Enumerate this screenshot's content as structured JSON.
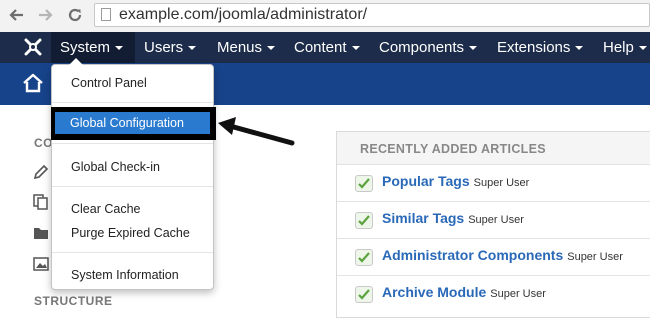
{
  "browser": {
    "url": "example.com/joomla/administrator/",
    "back_icon": "arrow-left-icon",
    "forward_icon": "arrow-right-icon",
    "reload_icon": "reload-icon"
  },
  "nav": {
    "logo": "joomla-logo-icon",
    "items": [
      {
        "label": "System"
      },
      {
        "label": "Users"
      },
      {
        "label": "Menus"
      },
      {
        "label": "Content"
      },
      {
        "label": "Components"
      },
      {
        "label": "Extensions"
      },
      {
        "label": "Help"
      }
    ]
  },
  "dropdown": {
    "items": [
      {
        "label": "Control Panel"
      },
      {
        "label": "Global Configuration",
        "highlighted": true
      },
      {
        "label": "Global Check-in"
      },
      {
        "label": "Clear Cache"
      },
      {
        "label": "Purge Expired Cache"
      },
      {
        "label": "System Information"
      }
    ]
  },
  "sidebar": {
    "heading_content": "CO",
    "heading_structure": "STRUCTURE"
  },
  "panel": {
    "title": "RECENTLY ADDED ARTICLES",
    "articles": [
      {
        "title": "Popular Tags",
        "author": "Super User"
      },
      {
        "title": "Similar Tags",
        "author": "Super User"
      },
      {
        "title": "Administrator Components",
        "author": "Super User"
      },
      {
        "title": "Archive Module",
        "author": "Super User"
      }
    ]
  },
  "colors": {
    "nav_bg": "#1c2c4a",
    "subheader_bg": "#17438a",
    "highlight": "#2a7bd0",
    "link": "#2a69b8"
  }
}
